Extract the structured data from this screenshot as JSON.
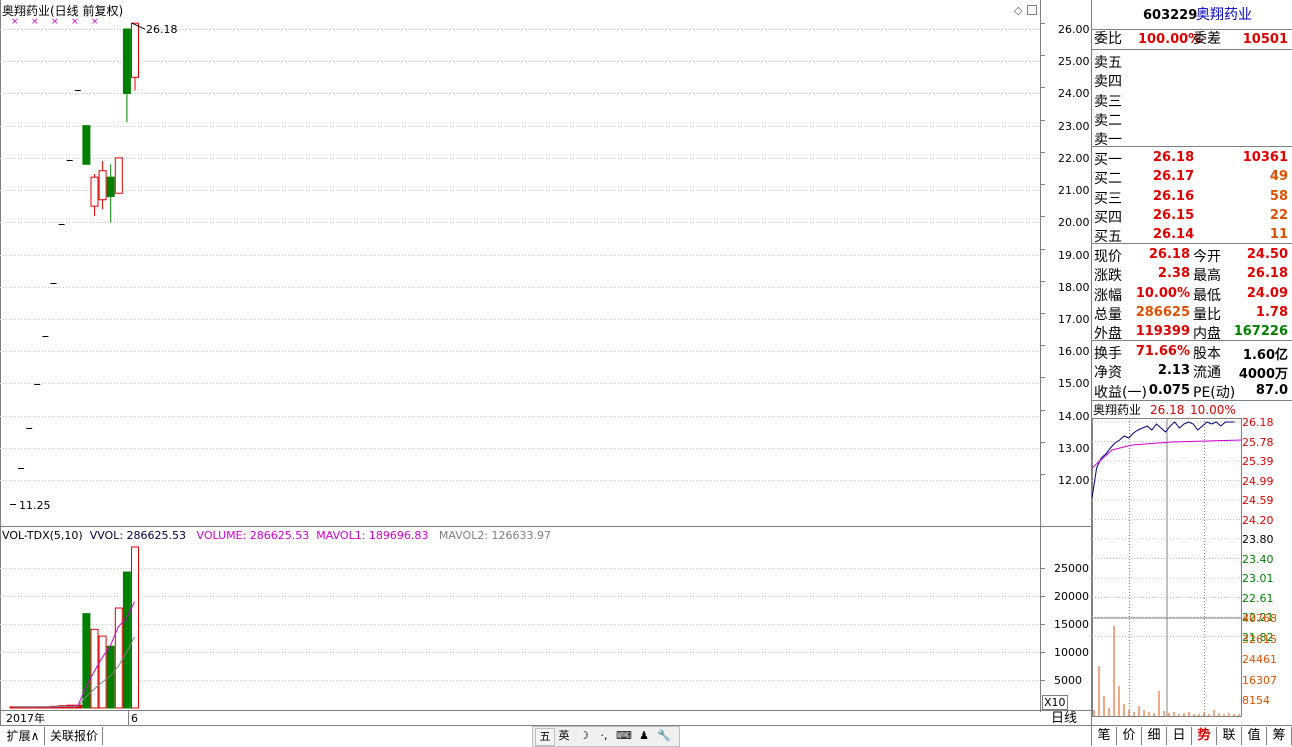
{
  "main_chart": {
    "title": "奥翔药业(日线 前复权)",
    "high_label": "26.18",
    "low_label": "11.25",
    "price_ticks": [
      "26.00",
      "25.00",
      "24.00",
      "23.00",
      "22.00",
      "21.00",
      "20.00",
      "19.00",
      "18.00",
      "17.00",
      "16.00",
      "15.00",
      "14.00",
      "13.00",
      "12.00"
    ],
    "diamond_icon": "diamond-icon"
  },
  "volume_panel": {
    "label": "VOL-TDX(5,10)",
    "vvol": "VVOL: 286625.53",
    "volume": "VOLUME: 286625.53",
    "mavol1": "MAVOL1: 189696.83",
    "mavol2": "MAVOL2: 126633.97",
    "ticks": [
      "25000",
      "20000",
      "15000",
      "10000",
      "5000"
    ],
    "multiplier": "X10"
  },
  "axis": {
    "year_label": "2017年",
    "month_label": "6",
    "period_label": "日线"
  },
  "bottom_tabs": {
    "expand": "扩展∧",
    "related": "关联报价"
  },
  "ime_toolbar": [
    "五",
    "英",
    "☽",
    "·,",
    "⌨",
    "♟",
    "🔧"
  ],
  "quote": {
    "code": "603229",
    "name": "奥翔药业",
    "weibi_label": "委比",
    "weibi": "100.00%",
    "weicha_label": "委差",
    "weicha": "10501",
    "sell": [
      {
        "label": "卖五"
      },
      {
        "label": "卖四"
      },
      {
        "label": "卖三"
      },
      {
        "label": "卖二"
      },
      {
        "label": "卖一"
      }
    ],
    "buy": [
      {
        "label": "买一",
        "price": "26.18",
        "vol": "10361"
      },
      {
        "label": "买二",
        "price": "26.17",
        "vol": "49"
      },
      {
        "label": "买三",
        "price": "26.16",
        "vol": "58"
      },
      {
        "label": "买四",
        "price": "26.15",
        "vol": "22"
      },
      {
        "label": "买五",
        "price": "26.14",
        "vol": "11"
      }
    ],
    "stats": [
      {
        "l1": "现价",
        "v1": "26.18",
        "l2": "今开",
        "v2": "24.50"
      },
      {
        "l1": "涨跌",
        "v1": "2.38",
        "l2": "最高",
        "v2": "26.18"
      },
      {
        "l1": "涨幅",
        "v1": "10.00%",
        "l2": "最低",
        "v2": "24.09"
      },
      {
        "l1": "总量",
        "v1": "286625",
        "l2": "量比",
        "v2": "1.78"
      },
      {
        "l1": "外盘",
        "v1": "119399",
        "l2": "内盘",
        "v2": "167226"
      },
      {
        "l1": "换手",
        "v1": "71.66%",
        "l2": "股本",
        "v2": "1.60亿"
      },
      {
        "l1": "净资",
        "v1": "2.13",
        "l2": "流通",
        "v2": "4000万"
      },
      {
        "l1": "收益(一)",
        "v1": "0.075",
        "l2": "PE(动)",
        "v2": "87.0"
      }
    ]
  },
  "mini_chart": {
    "name": "奥翔药业",
    "price": "26.18",
    "pct": "10.00%",
    "price_ticks_red": [
      "26.18",
      "25.78",
      "25.39",
      "24.99",
      "24.59",
      "24.20"
    ],
    "mid_tick": "23.80",
    "price_ticks_green": [
      "23.40",
      "23.01",
      "22.61",
      "22.21",
      "21.82"
    ],
    "vol_ticks": [
      "40768",
      "32615",
      "24461",
      "16307",
      "8154"
    ]
  },
  "right_tabs": [
    "笔",
    "价",
    "细",
    "日",
    "势",
    "联",
    "值",
    "筹"
  ],
  "chart_data": {
    "type": "candlestick",
    "title": "奥翔药业(日线 前复权)",
    "ylim": [
      11.0,
      26.4
    ],
    "candles": [
      {
        "o": 11.25,
        "h": 11.25,
        "l": 11.25,
        "c": 11.25,
        "vol": 200
      },
      {
        "o": 12.38,
        "h": 12.38,
        "l": 12.38,
        "c": 12.38,
        "vol": 200
      },
      {
        "o": 13.62,
        "h": 13.62,
        "l": 13.62,
        "c": 13.62,
        "vol": 200
      },
      {
        "o": 14.98,
        "h": 14.98,
        "l": 14.98,
        "c": 14.98,
        "vol": 200
      },
      {
        "o": 16.48,
        "h": 16.48,
        "l": 16.48,
        "c": 16.48,
        "vol": 200
      },
      {
        "o": 18.13,
        "h": 18.13,
        "l": 18.13,
        "c": 18.13,
        "vol": 300
      },
      {
        "o": 19.94,
        "h": 19.94,
        "l": 19.94,
        "c": 19.94,
        "vol": 400
      },
      {
        "o": 21.93,
        "h": 21.93,
        "l": 21.93,
        "c": 21.93,
        "vol": 500
      },
      {
        "o": 24.12,
        "h": 24.12,
        "l": 24.12,
        "c": 24.12,
        "vol": 500
      },
      {
        "o": 23.0,
        "h": 23.0,
        "l": 21.8,
        "c": 21.8,
        "vol": 16800
      },
      {
        "o": 20.5,
        "h": 21.5,
        "l": 20.2,
        "c": 21.4,
        "vol": 14000
      },
      {
        "o": 20.7,
        "h": 21.9,
        "l": 20.4,
        "c": 21.6,
        "vol": 12800
      },
      {
        "o": 21.4,
        "h": 21.8,
        "l": 20.0,
        "c": 20.8,
        "vol": 11000
      },
      {
        "o": 20.9,
        "h": 22.0,
        "l": 20.9,
        "c": 22.0,
        "vol": 17800
      },
      {
        "o": 26.0,
        "h": 26.0,
        "l": 23.1,
        "c": 24.0,
        "vol": 24200
      },
      {
        "o": 24.5,
        "h": 26.18,
        "l": 24.09,
        "c": 26.18,
        "vol": 28663
      }
    ],
    "volume_ylim": [
      0,
      28663
    ],
    "markers": [
      "×",
      "×",
      "×",
      "×",
      "×"
    ]
  }
}
